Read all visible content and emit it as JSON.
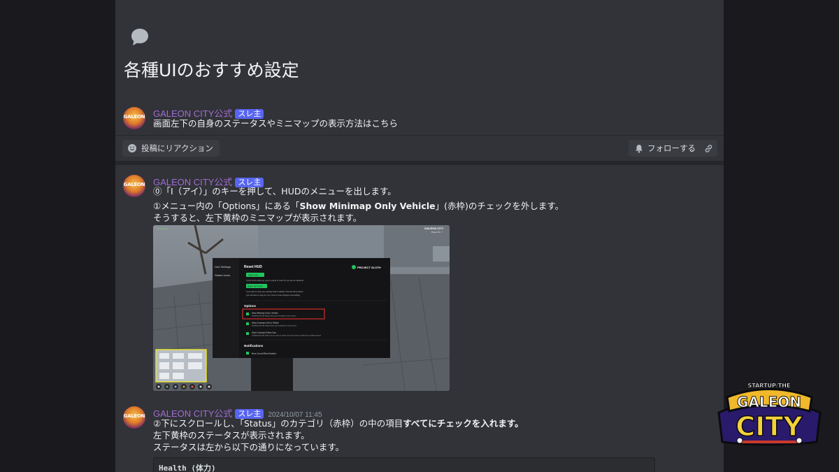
{
  "thread": {
    "title": "各種UIのおすすめ設定",
    "icon": "chat-bubble-icon"
  },
  "messages": [
    {
      "author": "GALEON CITY公式",
      "badge": "スレ主",
      "timestamp": "",
      "lines": [
        "画面左下の自身のステータスやミニマップの表示方法はこちら"
      ]
    },
    {
      "author": "GALEON CITY公式",
      "badge": "スレ主",
      "timestamp": "",
      "line1": "⓪「I（アイ）」のキーを押して、HUDのメニューを出します。",
      "line2_pre": "①メニュー内の「Options」にある「",
      "line2_bold": "Show Minimap Only Vehicle",
      "line2_post": "」(赤枠)のチェックを外します。",
      "line3": "そうすると、左下黄枠のミニマップが表示されます。"
    },
    {
      "author": "GALEON CITY公式",
      "badge": "スレ主",
      "timestamp": "2024/10/07 11:45",
      "line1_pre": "②下にスクロールし、「Status」のカテゴリ（赤枠）の中の項目",
      "line1_bold": "すべてにチェックを入れます。",
      "line2": "左下黄枠のステータスが表示されます。",
      "line3": "ステータスは左から以下の通りになっています。",
      "code": "Health (体力)"
    }
  ],
  "avatar_text": "GALEON",
  "actions": {
    "react": "投稿にリアクション",
    "follow": "フォローする"
  },
  "hud_menu": {
    "sidebar": [
      "Hud Settings",
      "Status Icons"
    ],
    "title": "Reset HUD",
    "brand": "PROJECT SLOTH",
    "reset_btn": "RESET HUD",
    "reset_desc": "If your hud is acting up, give it a good ol' reset! Or you can do /resethud",
    "settings_btn": "RESET SETTINGS",
    "settings_desc1": "If you want to reset your settings back to default; click this shiny button!",
    "settings_desc2": "(you will have to relog for your menu to reset changes successfully)",
    "options_header": "Options",
    "options": [
      {
        "label": "Show Minimap Only in Vehicle",
        "desc": "Disabling this will always keep your minimap on your screen"
      },
      {
        "label": "Show Compass Only in Vehicle",
        "desc": "Disabling this will always keep your compass on your screen"
      },
      {
        "label": "Show Compass Follow Cam",
        "desc": "Disabling this will make it so you can no longer use your mouse to rotate the compass around"
      }
    ],
    "notifications_header": "Notifications",
    "notifications": [
      {
        "label": "Menu Sound Effect Enabled"
      }
    ],
    "game_tag": "GALEON CITY",
    "game_player": "Player ID: 7",
    "game_status": "Grand Jobs"
  },
  "logo": {
    "top": "STARTUP/THE",
    "main1": "GALEON",
    "main2": "CITY"
  },
  "colors": {
    "author": "#a26bd4",
    "badge": "#5865f2",
    "highlight_red": "#e0312b",
    "highlight_yellow": "#f2ea2c"
  }
}
